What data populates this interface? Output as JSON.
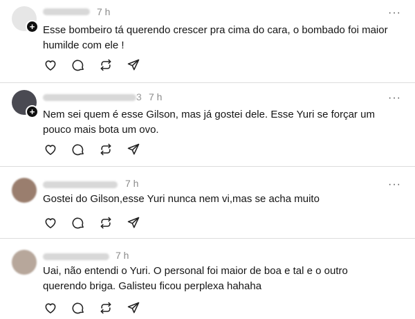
{
  "comments": [
    {
      "time": "7 h",
      "text": "Esse bombeiro tá querendo crescer pra cima do cara, o bombado foi maior humilde com ele !",
      "avatar_color": "#e6e6e6",
      "has_follow_badge": true
    },
    {
      "time": "7 h",
      "username_suffix": "3",
      "text": "Nem sei quem é esse Gilson, mas já gostei dele. Esse Yuri se forçar um pouco mais bota um ovo.",
      "avatar_color": "#4a4a52",
      "has_follow_badge": true
    },
    {
      "time": "7 h",
      "text": "Gostei do Gilson,esse Yuri nunca nem vi,mas se acha muito",
      "avatar_color": "#9a7e6e",
      "has_follow_badge": false
    },
    {
      "time": "7 h",
      "text": "Uai, não entendi o Yuri. O personal foi maior de boa e tal e o outro querendo briga. Galisteu ficou perplexa hahaha",
      "avatar_color": "#b7a79b",
      "has_follow_badge": false
    }
  ],
  "icons": {
    "more": "more-options-icon",
    "like": "heart-icon",
    "reply": "comment-icon",
    "repost": "repost-icon",
    "share": "share-icon"
  },
  "more_glyph": "···",
  "plus_glyph": "+"
}
